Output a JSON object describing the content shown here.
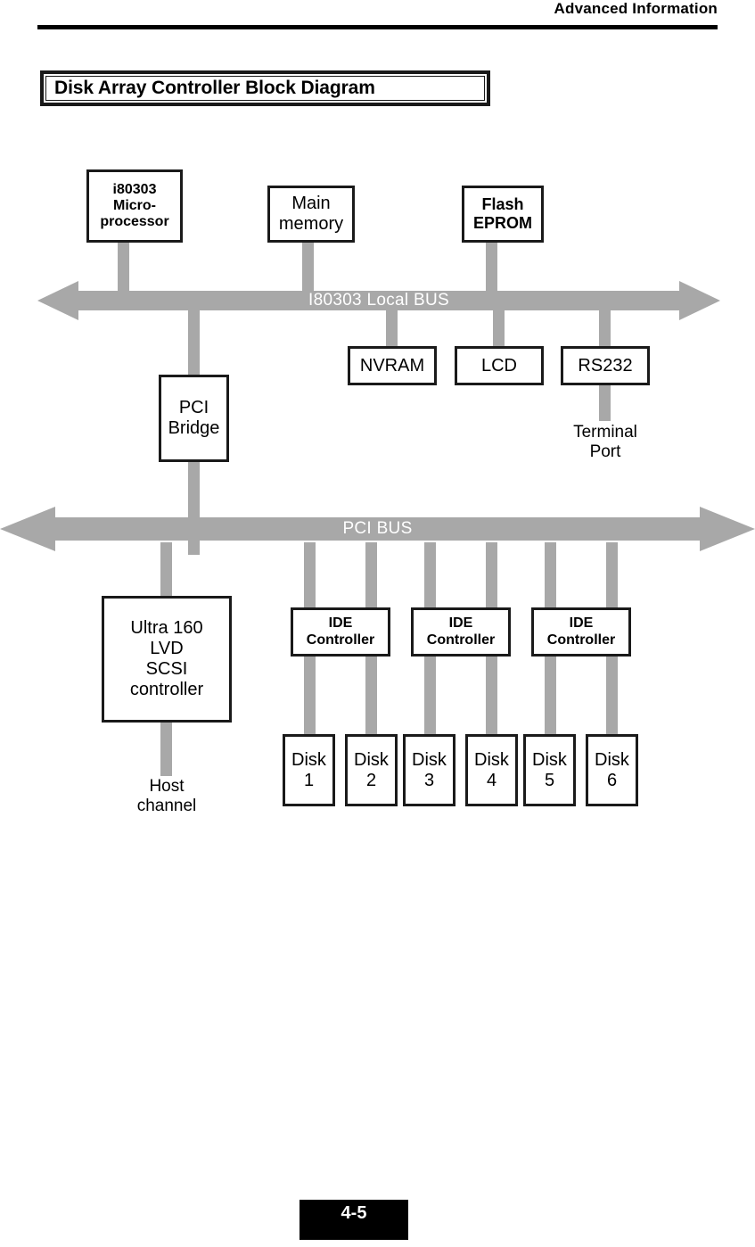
{
  "header": {
    "title": "Advanced Information"
  },
  "diagram": {
    "title": "Disk Array Controller Block Diagram",
    "buses": [
      {
        "id": "local-bus",
        "label": "I80303 Local BUS"
      },
      {
        "id": "pci-bus",
        "label": "PCI BUS"
      }
    ],
    "blocks": [
      {
        "id": "microprocessor",
        "lines": [
          "i80303",
          "Micro-",
          "processor"
        ],
        "bold": true
      },
      {
        "id": "main-memory",
        "lines": [
          "Main",
          "memory"
        ],
        "bold": false
      },
      {
        "id": "flash-eprom",
        "lines": [
          "Flash",
          "EPROM"
        ],
        "bold": true
      },
      {
        "id": "nvram",
        "lines": [
          "NVRAM"
        ],
        "bold": false
      },
      {
        "id": "lcd",
        "lines": [
          "LCD"
        ],
        "bold": false
      },
      {
        "id": "rs232",
        "lines": [
          "RS232"
        ],
        "bold": false
      },
      {
        "id": "pci-bridge",
        "lines": [
          "PCI",
          "Bridge"
        ],
        "bold": false
      },
      {
        "id": "scsi-controller",
        "lines": [
          "Ultra 160",
          "LVD",
          "SCSI",
          "controller"
        ],
        "bold": false
      },
      {
        "id": "ide-controller-1",
        "lines": [
          "IDE",
          "Controller"
        ],
        "bold": true
      },
      {
        "id": "ide-controller-2",
        "lines": [
          "IDE",
          "Controller"
        ],
        "bold": true
      },
      {
        "id": "ide-controller-3",
        "lines": [
          "IDE",
          "Controller"
        ],
        "bold": true
      },
      {
        "id": "disk-1",
        "lines": [
          "Disk",
          "1"
        ],
        "bold": false
      },
      {
        "id": "disk-2",
        "lines": [
          "Disk",
          "2"
        ],
        "bold": false
      },
      {
        "id": "disk-3",
        "lines": [
          "Disk",
          "3"
        ],
        "bold": false
      },
      {
        "id": "disk-4",
        "lines": [
          "Disk",
          "4"
        ],
        "bold": false
      },
      {
        "id": "disk-5",
        "lines": [
          "Disk",
          "5"
        ],
        "bold": false
      },
      {
        "id": "disk-6",
        "lines": [
          "Disk",
          "6"
        ],
        "bold": false
      }
    ],
    "captions": [
      {
        "id": "terminal-port",
        "lines": [
          "Terminal",
          "Port"
        ]
      },
      {
        "id": "host-channel",
        "lines": [
          "Host",
          "channel"
        ]
      }
    ],
    "colors": {
      "bus_fill": "#a8a8a8",
      "connector": "#a8a8a8",
      "block_border": "#1a1a1a",
      "bus_label_text": "#ffffff",
      "page_background": "#ffffff",
      "ink": "#000000"
    }
  },
  "footer": {
    "page_number": "4-5"
  }
}
